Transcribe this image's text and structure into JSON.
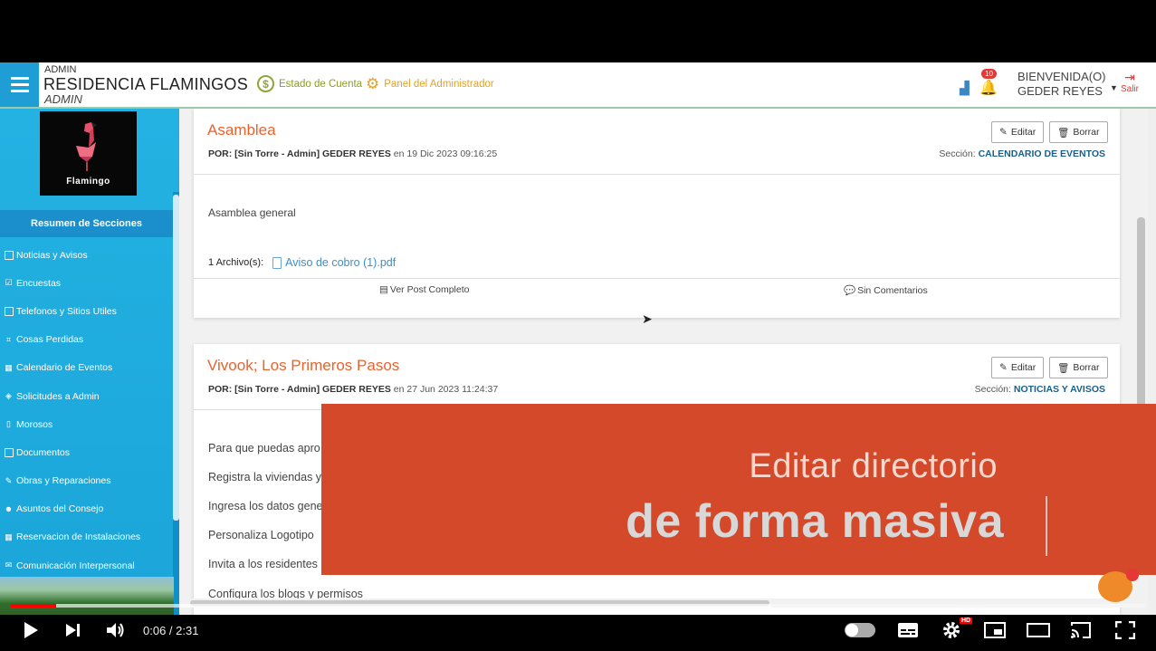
{
  "header": {
    "role_label": "ADMIN",
    "title": "RESIDENCIA FLAMINGOS",
    "subtitle": "ADMIN",
    "nav": [
      {
        "label": "Estado de Cuenta",
        "icon": "dollar-coin-icon"
      },
      {
        "label": "Panel del Administrador",
        "icon": "gears-icon"
      }
    ],
    "notification_count": "10",
    "welcome_line1": "BIENVENIDA(O)",
    "welcome_line2": "GEDER REYES",
    "logout_label": "Salir"
  },
  "sidebar": {
    "logo_text": "Flamingo",
    "section_header": "Resumen de Secciones",
    "items": [
      {
        "label": "Noticias y Avisos",
        "icon": "square-icon"
      },
      {
        "label": "Encuestas",
        "icon": "checkbox-icon"
      },
      {
        "label": "Telefonos y Sitios Utiles",
        "icon": "square-icon"
      },
      {
        "label": "Cosas Perdidas",
        "icon": "binoculars-icon"
      },
      {
        "label": "Calendario de Eventos",
        "icon": "calendar-icon"
      },
      {
        "label": "Solicitudes a Admin",
        "icon": "cubes-icon"
      },
      {
        "label": "Morosos",
        "icon": "file-icon"
      },
      {
        "label": "Documentos",
        "icon": "square-icon"
      },
      {
        "label": "Obras y Reparaciones",
        "icon": "wrench-icon"
      },
      {
        "label": "Asuntos del Consejo",
        "icon": "users-icon"
      },
      {
        "label": "Reservacion de Instalaciones",
        "icon": "calendar-icon"
      },
      {
        "label": "Comunicación Interpersonal",
        "icon": "comments-icon"
      }
    ]
  },
  "posts": [
    {
      "title": "Asamblea",
      "author": "POR: [Sin Torre - Admin] GEDER REYES",
      "date": " en 19 Dic 2023 09:16:25",
      "section_label": "Sección: ",
      "section_value": "CALENDARIO DE EVENTOS",
      "edit_label": "Editar",
      "delete_label": "Borrar",
      "body": "Asamblea general",
      "files_label": "1 Archivo(s):",
      "file_name": "Aviso de cobro (1).pdf",
      "view_label": "Ver Post Completo",
      "comments_label": "Sin Comentarios"
    },
    {
      "title": "Vivook; Los Primeros Pasos",
      "author": "POR: [Sin Torre - Admin] GEDER REYES",
      "date": " en 27 Jun 2023 11:24:37",
      "section_label": "Sección: ",
      "section_value": "NOTICIAS Y AVISOS",
      "edit_label": "Editar",
      "delete_label": "Borrar",
      "lines": [
        "Para que puedas apro",
        "Registra la viviendas y",
        "Ingresa los datos gene",
        "Personaliza Logotipo",
        "Invita a los residentes",
        "Configura los blogs y permisos"
      ]
    }
  ],
  "overlay": {
    "line1": "Editar directorio",
    "line2": "de forma masiva"
  },
  "player": {
    "time": "0:06 / 2:31",
    "progress_fraction": 0.04,
    "hd_badge": "HD"
  }
}
